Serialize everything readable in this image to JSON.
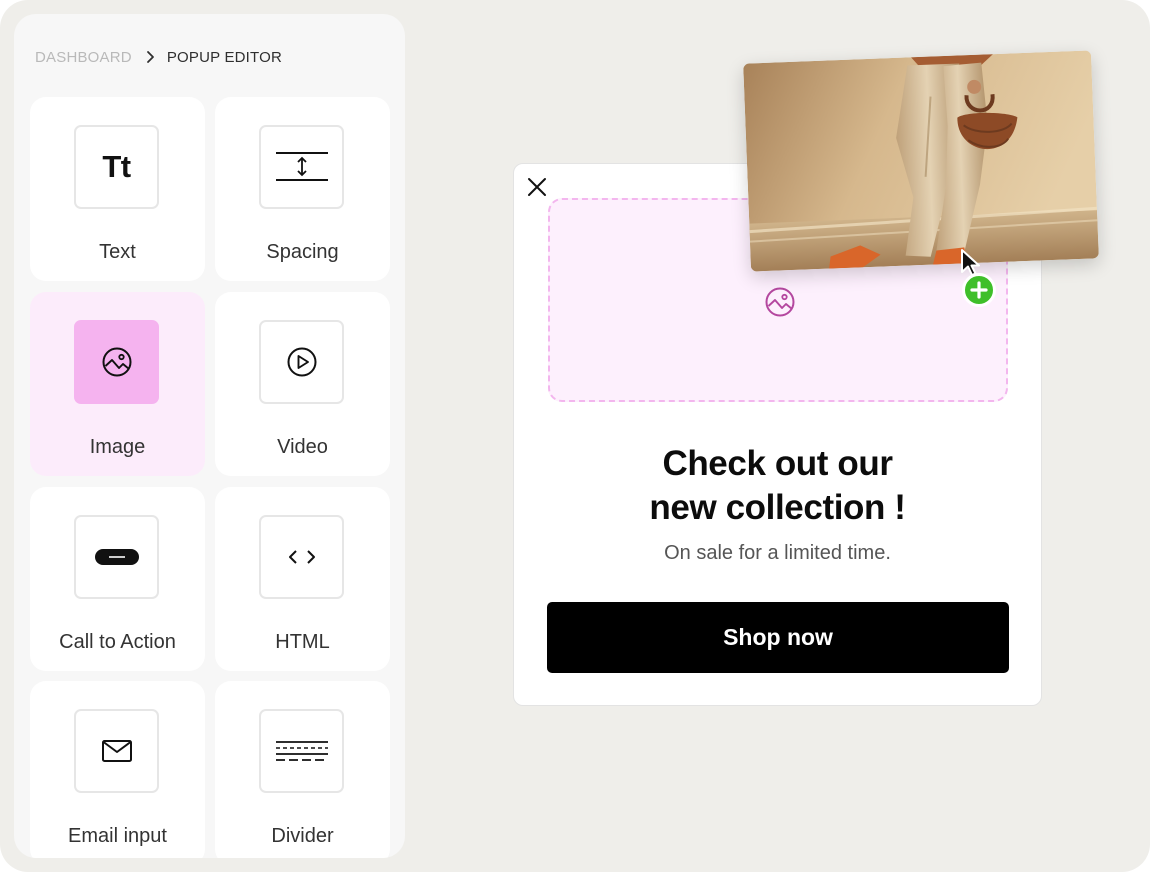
{
  "breadcrumb": {
    "root": "DASHBOARD",
    "current": "POPUP EDITOR"
  },
  "blocks": [
    {
      "label": "Text",
      "icon": "text-tt-icon",
      "glyph": "Tt"
    },
    {
      "label": "Spacing",
      "icon": "spacing-icon"
    },
    {
      "label": "Image",
      "icon": "image-icon",
      "active": true
    },
    {
      "label": "Video",
      "icon": "play-icon"
    },
    {
      "label": "Call to Action",
      "icon": "button-pill-icon"
    },
    {
      "label": "HTML",
      "icon": "code-brackets-icon"
    },
    {
      "label": "Email input",
      "icon": "envelope-icon"
    },
    {
      "label": "Divider",
      "icon": "divider-icon"
    }
  ],
  "popup": {
    "headline_line1": "Check out our",
    "headline_line2": "new collection !",
    "subtext": "On sale for a limited time.",
    "cta_label": "Shop now"
  },
  "colors": {
    "accent_pink": "#f5b3ef",
    "active_tile_bg": "#fcecfb",
    "drop_zone_border": "#f3b6ee",
    "add_badge": "#3fbf2a",
    "cta_bg": "#000000"
  }
}
